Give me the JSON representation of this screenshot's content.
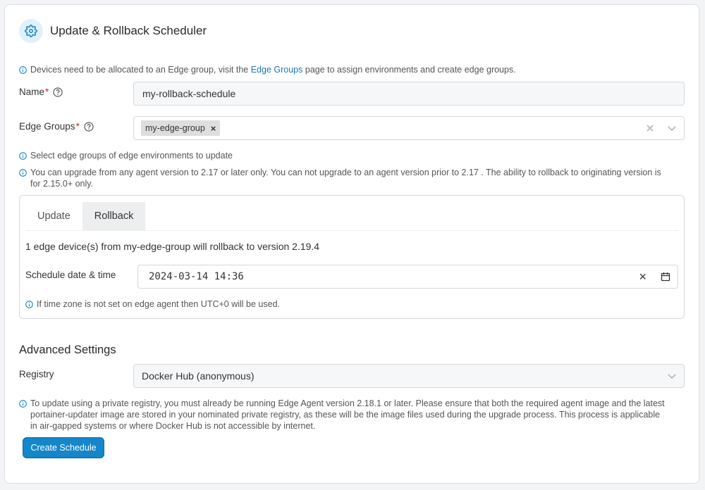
{
  "header": {
    "title": "Update & Rollback Scheduler",
    "icon": "gear-icon"
  },
  "info_groups": {
    "prefix": "Devices need to be allocated to an Edge group, visit the",
    "link": "Edge Groups",
    "suffix": "page to assign environments and create edge groups."
  },
  "name_field": {
    "label": "Name",
    "required": "*",
    "value": "my-rollback-schedule"
  },
  "groups_field": {
    "label": "Edge Groups",
    "required": "*",
    "chips": [
      "my-edge-group"
    ],
    "chip_remove": "×"
  },
  "info_select": "Select edge groups of edge environments to update",
  "info_version_line1": "You can upgrade from any agent version to 2.17 or later only. You can not upgrade to an agent version prior to 2.17 . The ability to rollback to originating version is",
  "info_version_line2": "for 2.15.0+ only.",
  "tabs": [
    {
      "label": "Update",
      "active": false
    },
    {
      "label": "Rollback",
      "active": true
    }
  ],
  "rollback_message": "1 edge device(s) from my-edge-group will rollback to version 2.19.4",
  "schedule": {
    "label": "Schedule date & time",
    "value": "2024-03-14 14:36",
    "clear": "×"
  },
  "info_timezone": "If time zone is not set on edge agent then UTC+0 will be used.",
  "advanced": {
    "title": "Advanced Settings"
  },
  "registry": {
    "label": "Registry",
    "value": "Docker Hub (anonymous)"
  },
  "info_registry_line1": "To update using a private registry, you must already be running Edge Agent version 2.18.1 or later. Please ensure that both the required agent image and the latest",
  "info_registry_line2": "portainer-updater image are stored in your nominated private registry, as these will be the image files used during the upgrade process. This process is applicable",
  "info_registry_line3": "in air-gapped systems or where Docker Hub is not accessible by internet.",
  "submit": {
    "label": "Create Schedule"
  },
  "colors": {
    "accent": "#1586c9",
    "link": "#1e73b8",
    "required": "#c6262e"
  }
}
